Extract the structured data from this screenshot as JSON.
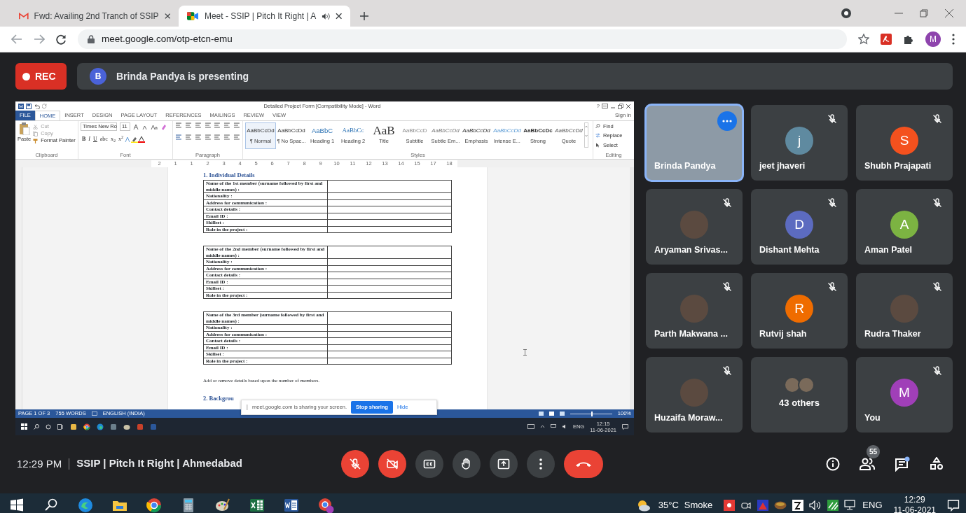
{
  "browser": {
    "tabs": [
      {
        "title": "Fwd: Availing 2nd Tranch of SSIP",
        "kind": "mail",
        "selected": false,
        "audio": false
      },
      {
        "title": "Meet - SSIP | Pitch It Right | A",
        "kind": "meet",
        "selected": true,
        "audio": true
      }
    ],
    "url": "meet.google.com/otp-etcn-emu",
    "profile_initial": "M"
  },
  "meeting": {
    "rec_label": "REC",
    "presenter_initial": "B",
    "presenter_text": "Brinda Pandya is presenting"
  },
  "shared_screen": {
    "word": {
      "title": "Detailed Project Form [Compatibility Mode] - Word",
      "help": "?",
      "sign_in": "Sign in",
      "tabs": [
        {
          "label": "FILE",
          "kind": "file",
          "selected": false
        },
        {
          "label": "HOME",
          "kind": "tab",
          "selected": true
        },
        {
          "label": "INSERT",
          "kind": "tab",
          "selected": false
        },
        {
          "label": "DESIGN",
          "kind": "tab",
          "selected": false
        },
        {
          "label": "PAGE LAYOUT",
          "kind": "tab",
          "selected": false
        },
        {
          "label": "REFERENCES",
          "kind": "tab",
          "selected": false
        },
        {
          "label": "MAILINGS",
          "kind": "tab",
          "selected": false
        },
        {
          "label": "REVIEW",
          "kind": "tab",
          "selected": false
        },
        {
          "label": "VIEW",
          "kind": "tab",
          "selected": false
        }
      ],
      "clipboard": {
        "paste": "Paste",
        "label": "Clipboard",
        "items": [
          {
            "label": "Cut",
            "disabled": true
          },
          {
            "label": "Copy",
            "disabled": true
          },
          {
            "label": "Format Painter",
            "disabled": false
          }
        ]
      },
      "font": {
        "name": "Times New Ro",
        "size": "11",
        "label": "Font",
        "buttons": [
          "B",
          "I",
          "U",
          "abc",
          "x$_{2}$",
          "x$^{2}$"
        ]
      },
      "paragraph": {
        "label": "Paragraph"
      },
      "styles": {
        "label": "Styles",
        "items": [
          {
            "sample": "AaBbCcDd",
            "name": "¶ Normal",
            "kind": "normal",
            "selected": true
          },
          {
            "sample": "AaBbCcDd",
            "name": "¶ No Spac...",
            "kind": "normal",
            "selected": false
          },
          {
            "sample": "AaBbC",
            "name": "Heading 1",
            "kind": "heading1",
            "selected": false
          },
          {
            "sample": "AaBbCc",
            "name": "Heading 2",
            "kind": "heading2",
            "selected": false
          },
          {
            "sample": "AaB",
            "name": "Title",
            "kind": "title",
            "selected": false
          },
          {
            "sample": "AaBbCcD",
            "name": "Subtitle",
            "kind": "subtitle",
            "selected": false
          },
          {
            "sample": "AaBbCcDd",
            "name": "Subtle Em...",
            "kind": "subtle",
            "selected": false
          },
          {
            "sample": "AaBbCcDd",
            "name": "Emphasis",
            "kind": "emphasis",
            "selected": false
          },
          {
            "sample": "AaBbCcDd",
            "name": "Intense E...",
            "kind": "intense",
            "selected": false
          },
          {
            "sample": "AaBbCcDc",
            "name": "Strong",
            "kind": "strong",
            "selected": false
          },
          {
            "sample": "AaBbCcDd",
            "name": "Quote",
            "kind": "quote",
            "selected": false
          }
        ]
      },
      "editing": {
        "label": "Editing",
        "items": [
          "Find",
          "Replace",
          "Select"
        ]
      },
      "ruler": [
        "2",
        "1",
        "1",
        "2",
        "3",
        "4",
        "5",
        "6",
        "7",
        "8",
        "9",
        "10",
        "11",
        "12",
        "13",
        "14",
        "15",
        "17",
        "18"
      ],
      "document": {
        "heading": "1. Individual Details",
        "tables": [
          {
            "rows": [
              "Name of the 1st member (surname followed by first and middle names) :",
              "Nationality :",
              "Address for communication :",
              "Contact details :",
              "Email ID :",
              "Skillset :",
              "Role in the project :"
            ]
          },
          {
            "rows": [
              "Name of the 2nd member (surname followed by first and middle names) :",
              "Nationality :",
              "Address for communication :",
              "Contact details :",
              "Email ID :",
              "Skillset :",
              "Role in the project :"
            ]
          },
          {
            "rows": [
              "Name of the 3rd member (surname followed by first and middle names) :",
              "Nationality :",
              "Address for communication :",
              "Contact details :",
              "Email ID :",
              "Skillset :",
              "Role in the project :"
            ]
          }
        ],
        "note": "Add or remove details based upon the number of members.",
        "next_heading": "2. Backgrou"
      },
      "status": {
        "page": "PAGE 1 OF 3",
        "words": "755 WORDS",
        "language": "ENGLISH (INDIA)",
        "zoom": {
          "level": 0.5
        },
        "zoom_text": "100%"
      }
    },
    "share_notice": {
      "text": "meet.google.com is sharing your screen.",
      "stop": "Stop sharing",
      "hide": "Hide"
    },
    "taskbar": {
      "lang": "ENG",
      "time": "12:15",
      "date": "11-06-2021"
    }
  },
  "participants": [
    {
      "name": "Brinda Pandya",
      "kind": "video",
      "muted": false,
      "highlighted": true
    },
    {
      "name": "jeet jhaveri",
      "kind": "letter",
      "initial": "j",
      "color": "#5f8aa0",
      "muted": true,
      "highlighted": false
    },
    {
      "name": "Shubh Prajapati",
      "kind": "letter",
      "initial": "S",
      "color": "#f4511e",
      "muted": true,
      "highlighted": false
    },
    {
      "name": "Aryaman Srivas...",
      "kind": "photo",
      "muted": true,
      "highlighted": false
    },
    {
      "name": "Dishant Mehta",
      "kind": "letter",
      "initial": "D",
      "color": "#5c6bc0",
      "muted": true,
      "highlighted": false
    },
    {
      "name": "Aman Patel",
      "kind": "letter",
      "initial": "A",
      "color": "#7cb342",
      "muted": true,
      "highlighted": false
    },
    {
      "name": "Parth Makwana ...",
      "kind": "photo",
      "muted": true,
      "highlighted": false
    },
    {
      "name": "Rutvij shah",
      "kind": "letter",
      "initial": "R",
      "color": "#ef6c00",
      "muted": true,
      "highlighted": false
    },
    {
      "name": "Rudra Thaker",
      "kind": "photo",
      "muted": true,
      "highlighted": false
    },
    {
      "name": "Huzaifa Moraw...",
      "kind": "photo",
      "muted": true,
      "highlighted": false
    },
    {
      "name": "43 others",
      "kind": "group",
      "muted": false,
      "highlighted": false
    },
    {
      "name": "You",
      "kind": "letter",
      "initial": "M",
      "color": "#a03fb8",
      "muted": true,
      "highlighted": false
    }
  ],
  "bottom_bar": {
    "time": "12:29 PM",
    "title": "SSIP | Pitch It Right | Ahmedabad",
    "toggles": [
      {
        "kind": "mic",
        "active": false
      },
      {
        "kind": "camera",
        "active": false
      },
      {
        "kind": "captions",
        "active": false
      },
      {
        "kind": "hand",
        "active": false
      },
      {
        "kind": "present",
        "active": false
      }
    ],
    "people_count": "55",
    "chat_unread": true
  },
  "taskbar": {
    "temperature": "35°C",
    "weather": "Smoke",
    "lang": "ENG",
    "time": "12:29",
    "date": "11-06-2021"
  }
}
